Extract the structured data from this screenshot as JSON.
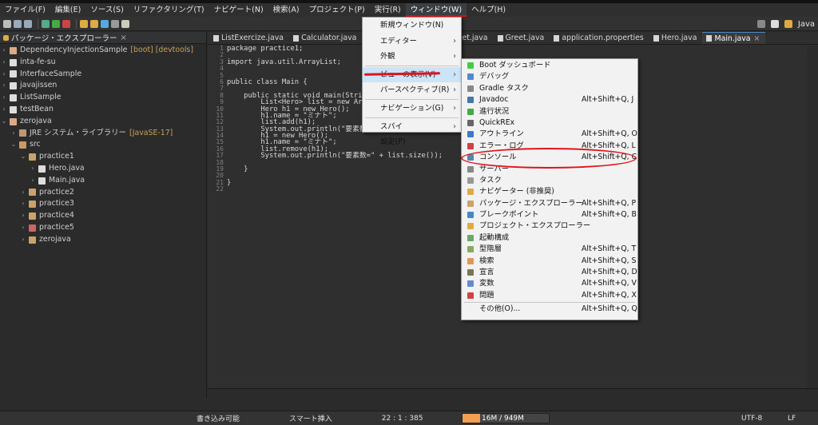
{
  "menubar": {
    "items": [
      "ファイル(F)",
      "編集(E)",
      "ソース(S)",
      "リファクタリング(T)",
      "ナビゲート(N)",
      "検索(A)",
      "プロジェクト(P)",
      "実行(R)",
      "ウィンドウ(W)",
      "ヘルプ(H)"
    ]
  },
  "perspective": {
    "label": "Java"
  },
  "explorer": {
    "title": "パッケージ・エクスプローラー",
    "items": [
      {
        "label": "DependencyInjectionSample",
        "deco": "[boot] [devtools]"
      },
      {
        "label": "inta-fe-su",
        "deco": ""
      },
      {
        "label": "InterfaceSample",
        "deco": ""
      },
      {
        "label": "javajissen",
        "deco": ""
      },
      {
        "label": "ListSample",
        "deco": ""
      },
      {
        "label": "testBean",
        "deco": ""
      },
      {
        "label": "zerojava",
        "deco": ""
      },
      {
        "label": "JRE システム・ライブラリー",
        "deco": "[JavaSE-17]"
      },
      {
        "label": "src",
        "deco": ""
      },
      {
        "label": "practice1",
        "deco": ""
      },
      {
        "label": "Hero.java",
        "deco": ""
      },
      {
        "label": "Main.java",
        "deco": ""
      },
      {
        "label": "practice2",
        "deco": ""
      },
      {
        "label": "practice3",
        "deco": ""
      },
      {
        "label": "practice4",
        "deco": ""
      },
      {
        "label": "practice5",
        "deco": ""
      },
      {
        "label": "zerojava",
        "deco": ""
      }
    ]
  },
  "tabs": [
    "ListExercize.java",
    "Calculator.java",
    "et.java",
    "Greet.java",
    "application.properties",
    "Hero.java",
    "Main.java"
  ],
  "line_numbers": [
    "1",
    "2",
    "3",
    "4",
    "5",
    "6",
    "7",
    "8",
    "9",
    "10",
    "11",
    "12",
    "13",
    "14",
    "15",
    "16",
    "17",
    "18",
    "19",
    "20",
    "21",
    "22"
  ],
  "code": [
    "package practice1;",
    "",
    "import java.util.ArrayList;",
    "",
    "",
    "public class Main {",
    "",
    "    public static void main(String[",
    "        List<Hero> list = new ArrayL",
    "        Hero h1 = new Hero();",
    "        h1.name = \"ミナト\";",
    "        list.add(h1);",
    "        System.out.println(\"要素数=\"",
    "        h1 = new Hero();",
    "        h1.name = \"ミナト\";",
    "        list.remove(h1);",
    "        System.out.println(\"要素数=\" + list.size());",
    "",
    "    }",
    "",
    "}",
    ""
  ],
  "window_menu": {
    "items": [
      {
        "label": "新規ウィンドウ(N)",
        "sub": ""
      },
      {
        "label": "エディター",
        "sub": "›"
      },
      {
        "label": "外観",
        "sub": "›"
      },
      {
        "label": "ビューの表示(V)",
        "sub": "›"
      },
      {
        "label": "パースペクティブ(R)",
        "sub": "›"
      },
      {
        "label": "ナビゲーション(G)",
        "sub": "›"
      },
      {
        "label": "スパイ",
        "sub": "›"
      },
      {
        "label": "設定(P)",
        "sub": ""
      }
    ]
  },
  "view_menu": {
    "items": [
      {
        "label": "Boot ダッシュボード",
        "acc": ""
      },
      {
        "label": "デバッグ",
        "acc": ""
      },
      {
        "label": "Gradle タスク",
        "acc": ""
      },
      {
        "label": "Javadoc",
        "acc": "Alt+Shift+Q, J"
      },
      {
        "label": "進行状況",
        "acc": ""
      },
      {
        "label": "QuickREx",
        "acc": ""
      },
      {
        "label": "アウトライン",
        "acc": "Alt+Shift+Q, O"
      },
      {
        "label": "エラー・ログ",
        "acc": "Alt+Shift+Q, L"
      },
      {
        "label": "コンソール",
        "acc": "Alt+Shift+Q, C"
      },
      {
        "label": "サーバー",
        "acc": ""
      },
      {
        "label": "タスク",
        "acc": ""
      },
      {
        "label": "ナビゲーター (非推奨)",
        "acc": ""
      },
      {
        "label": "パッケージ・エクスプローラー",
        "acc": "Alt+Shift+Q, P"
      },
      {
        "label": "ブレークポイント",
        "acc": "Alt+Shift+Q, B"
      },
      {
        "label": "プロジェクト・エクスプローラー",
        "acc": ""
      },
      {
        "label": "起動構成",
        "acc": ""
      },
      {
        "label": "型階層",
        "acc": "Alt+Shift+Q, T"
      },
      {
        "label": "検索",
        "acc": "Alt+Shift+Q, S"
      },
      {
        "label": "宣言",
        "acc": "Alt+Shift+Q, D"
      },
      {
        "label": "変数",
        "acc": "Alt+Shift+Q, V"
      },
      {
        "label": "問題",
        "acc": "Alt+Shift+Q, X"
      },
      {
        "label": "その他(O)...",
        "acc": "Alt+Shift+Q, Q"
      }
    ]
  },
  "status": {
    "mode": "書き込み可能",
    "insert": "スマート挿入",
    "position": "22 : 1 : 385",
    "heap": "16M / 949M",
    "encoding": "UTF-8",
    "eol": "LF"
  },
  "colors": {
    "annotation": "#e0131a",
    "heap": "#f0a050"
  }
}
